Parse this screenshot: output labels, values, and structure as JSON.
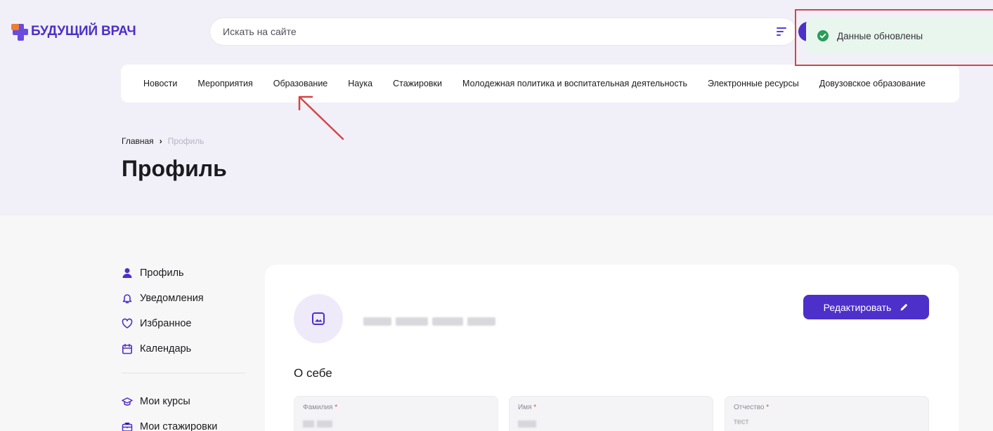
{
  "brand": {
    "logo_text": "БУДУЩИЙ ВРАЧ"
  },
  "search": {
    "placeholder": "Искать на сайте"
  },
  "nav": {
    "items": [
      "Новости",
      "Мероприятия",
      "Образование",
      "Наука",
      "Стажировки",
      "Молодежная политика и воспитательная деятельность",
      "Электронные ресурсы",
      "Довузовское образование"
    ]
  },
  "breadcrumb": {
    "home": "Главная",
    "separator": "›",
    "current": "Профиль"
  },
  "page": {
    "title": "Профиль"
  },
  "sidebar": {
    "items": [
      {
        "label": "Профиль",
        "icon": "user-icon"
      },
      {
        "label": "Уведомления",
        "icon": "bell-icon"
      },
      {
        "label": "Избранное",
        "icon": "heart-icon"
      },
      {
        "label": "Календарь",
        "icon": "calendar-icon"
      },
      {
        "label": "Мои курсы",
        "icon": "graduation-cap-icon"
      },
      {
        "label": "Мои стажировки",
        "icon": "briefcase-icon"
      }
    ]
  },
  "profile": {
    "edit_label": "Редактировать",
    "about_title": "О себе",
    "fields": [
      {
        "label": "Фамилия",
        "required": "*"
      },
      {
        "label": "Имя",
        "required": "*"
      },
      {
        "label": "Отчество",
        "required": "*",
        "value": "тест"
      }
    ]
  },
  "toast": {
    "message": "Данные обновлены",
    "status": "success"
  },
  "colors": {
    "brand": "#4d2fc9",
    "accent_orange": "#f07d32",
    "hero_bg": "#f1f0f8",
    "toast_bg": "#e9f6ee",
    "success": "#2a9d5a",
    "annotation_red": "#d64545"
  }
}
